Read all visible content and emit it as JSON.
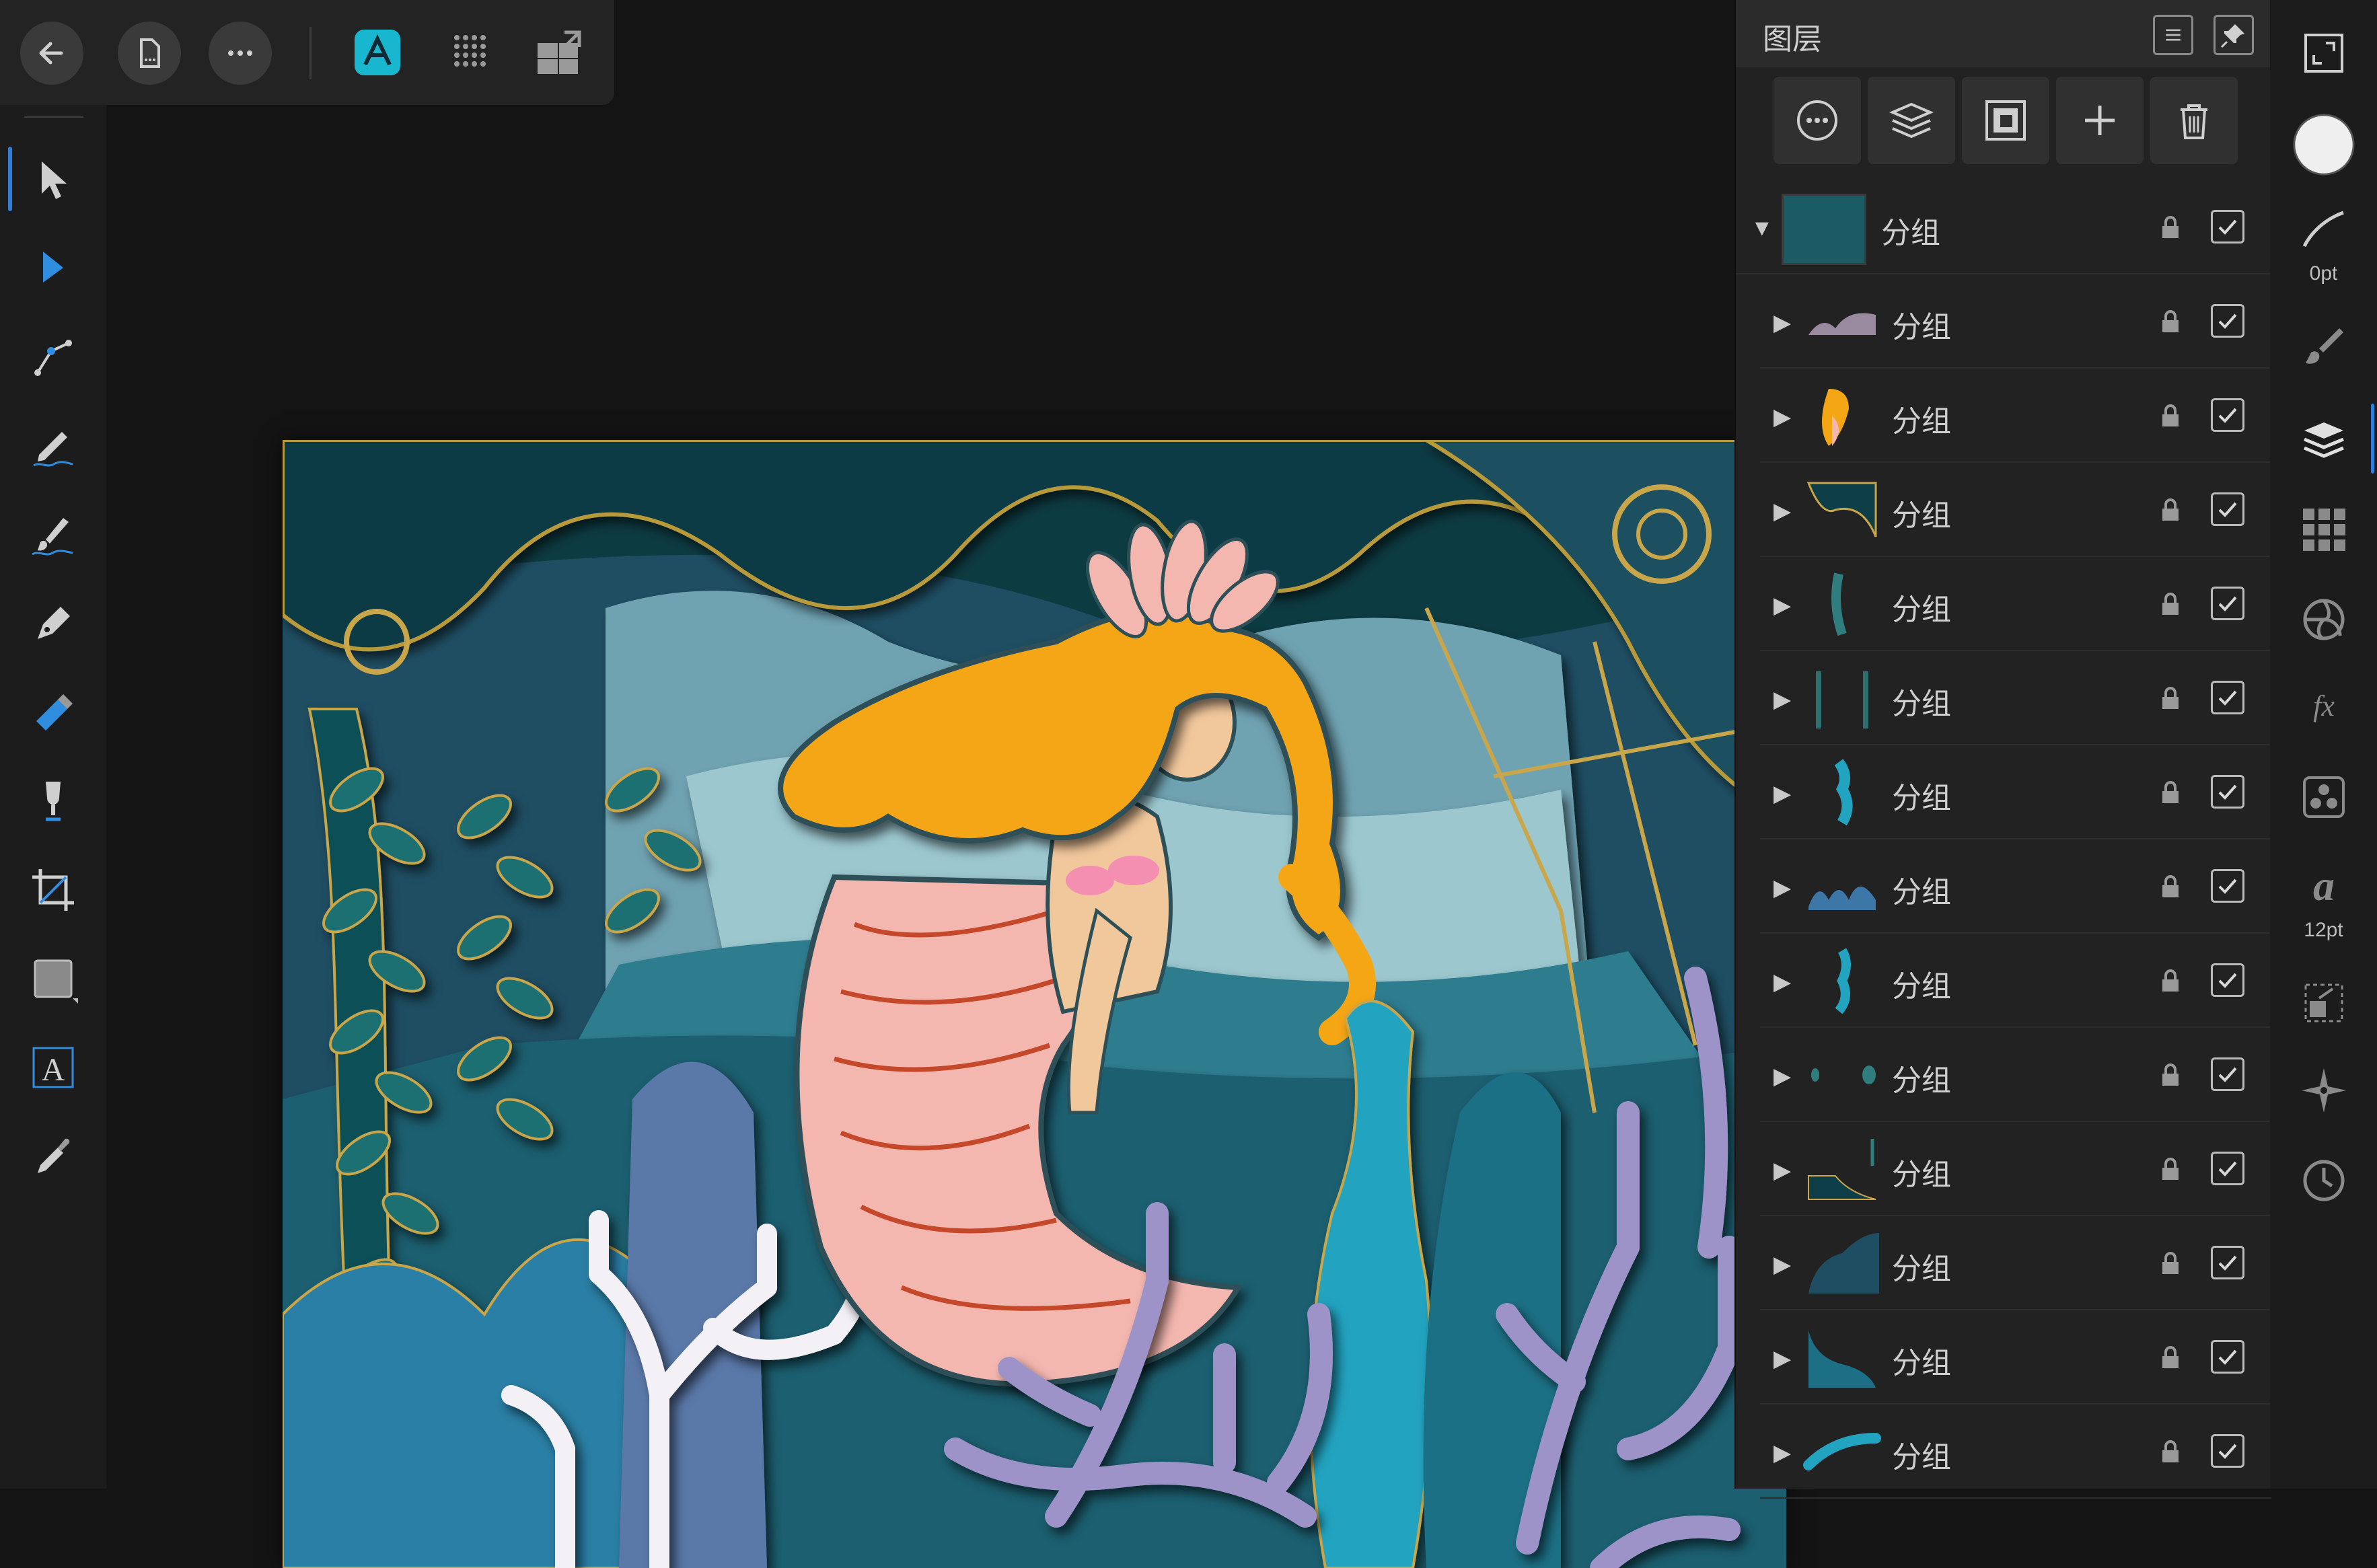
{
  "top_bar": {
    "icons": [
      "back-arrow-icon",
      "document-icon",
      "more-icon",
      "designer-persona-icon",
      "pixel-persona-icon",
      "export-persona-icon"
    ]
  },
  "tools": [
    {
      "name": "move-tool-icon",
      "selected": true
    },
    {
      "name": "node-tool-icon",
      "selected": false
    },
    {
      "name": "corner-tool-icon",
      "selected": false
    },
    {
      "name": "pencil-tool-icon",
      "selected": false
    },
    {
      "name": "vector-brush-tool-icon",
      "selected": false
    },
    {
      "name": "pen-tool-icon",
      "selected": false
    },
    {
      "name": "fill-tool-icon",
      "selected": false
    },
    {
      "name": "transparency-tool-icon",
      "selected": false
    },
    {
      "name": "crop-tool-icon",
      "selected": false
    },
    {
      "name": "shape-tool-icon",
      "selected": false
    },
    {
      "name": "text-tool-icon",
      "selected": false
    },
    {
      "name": "color-picker-tool-icon",
      "selected": false
    }
  ],
  "layers_panel": {
    "title": "图层",
    "actions": [
      "more-icon",
      "layer-stack-icon",
      "mask-icon",
      "add-icon",
      "trash-icon"
    ],
    "root_layer": {
      "name": "分组",
      "expanded": true,
      "visible": true
    },
    "layers": [
      {
        "name": "分组",
        "visible": true
      },
      {
        "name": "分组",
        "visible": true
      },
      {
        "name": "分组",
        "visible": true
      },
      {
        "name": "分组",
        "visible": true
      },
      {
        "name": "分组",
        "visible": true
      },
      {
        "name": "分组",
        "visible": true
      },
      {
        "name": "分组",
        "visible": true
      },
      {
        "name": "分组",
        "visible": true
      },
      {
        "name": "分组",
        "visible": true
      },
      {
        "name": "分组",
        "visible": true
      },
      {
        "name": "分组",
        "visible": true
      },
      {
        "name": "分组",
        "visible": true
      },
      {
        "name": "分组",
        "visible": true
      }
    ]
  },
  "studio": {
    "stroke_width": "0pt",
    "font_size": "12pt"
  },
  "colors": {
    "accent": "#2f7fd8",
    "persona_active": "#19b6d0",
    "artwork_bg": "#0d3b42",
    "hair": "#f5a615",
    "tail": "#f4b7b0",
    "coral_purple": "#9d93c9"
  }
}
